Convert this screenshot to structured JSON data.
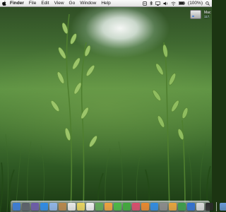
{
  "menubar": {
    "apple_icon": "apple-icon",
    "items": [
      "Finder",
      "File",
      "Edit",
      "View",
      "Go",
      "Window",
      "Help"
    ],
    "status": {
      "battery_percent": "(100%)",
      "icons": [
        "input-menu-icon",
        "bluetooth-icon",
        "airplay-icon",
        "volume-icon",
        "wifi-icon",
        "battery-icon",
        "spotlight-icon"
      ]
    }
  },
  "desktop": {
    "wallpaper": "green grass field with oat stalks",
    "disk": {
      "name": "Mac",
      "subtitle": "117."
    }
  },
  "dock": {
    "apps": [
      {
        "name": "finder",
        "color": "#3a7bd5"
      },
      {
        "name": "launchpad",
        "color": "#5a5f69"
      },
      {
        "name": "mission-control",
        "color": "#6b5aa8"
      },
      {
        "name": "safari",
        "color": "#2d8ae6"
      },
      {
        "name": "mail",
        "color": "#8fb4e8"
      },
      {
        "name": "contacts",
        "color": "#b8864a"
      },
      {
        "name": "calendar",
        "color": "#e8e8e8"
      },
      {
        "name": "notes",
        "color": "#e8d35c"
      },
      {
        "name": "reminders",
        "color": "#f0f0f0"
      },
      {
        "name": "maps",
        "color": "#5fa854"
      },
      {
        "name": "photos",
        "color": "#f0a13c"
      },
      {
        "name": "messages",
        "color": "#49b843"
      },
      {
        "name": "facetime",
        "color": "#3fa83a"
      },
      {
        "name": "itunes",
        "color": "#d94b6b"
      },
      {
        "name": "ibooks",
        "color": "#e9872c"
      },
      {
        "name": "app-store",
        "color": "#2f8ae0"
      },
      {
        "name": "system-preferences",
        "color": "#8a8a8a"
      },
      {
        "name": "pages",
        "color": "#e6a23a"
      },
      {
        "name": "numbers",
        "color": "#3b9c48"
      },
      {
        "name": "keynote",
        "color": "#2f6fd0"
      },
      {
        "name": "preview",
        "color": "#d9d9d9"
      },
      {
        "name": "terminal",
        "color": "#2a2a2a"
      }
    ],
    "extras": [
      {
        "name": "downloads-stack",
        "color": "#6a9ad8"
      },
      {
        "name": "trash",
        "color": "#c8ccd2"
      }
    ]
  }
}
